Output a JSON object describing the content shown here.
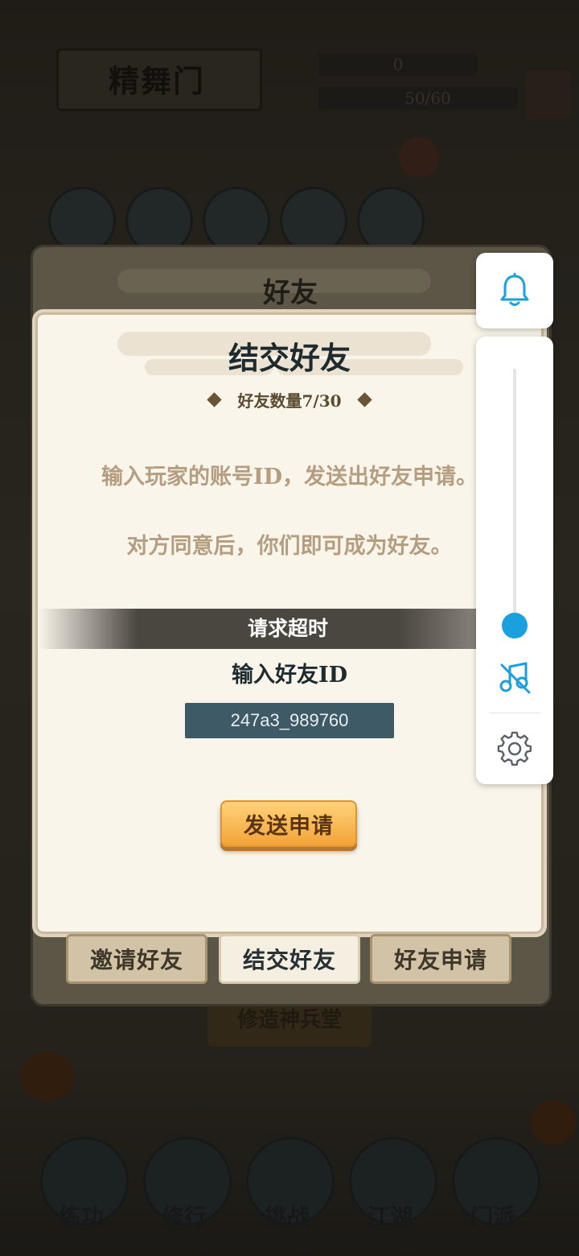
{
  "background": {
    "sect_name": "精舞门",
    "resource_value": "0",
    "stamina_value": "50/60",
    "behind_button_label": "修造神兵堂",
    "bottom_nav": [
      "练功",
      "修行",
      "挑战",
      "江湖",
      "门派"
    ]
  },
  "outer_panel": {
    "title": "好友"
  },
  "card": {
    "title": "结交好友",
    "friend_count_label": "好友数量7/30",
    "description_line1": "输入玩家的账号ID，发送出好友申请。",
    "description_line2": "对方同意后，你们即可成为好友。",
    "status_message": "请求超时",
    "id_label": "输入好友ID",
    "id_value": "247a3_989760",
    "send_button_label": "发送申请"
  },
  "tabs": [
    {
      "label": "邀请好友",
      "active": false
    },
    {
      "label": "结交好友",
      "active": true
    },
    {
      "label": "好友申请",
      "active": false
    }
  ],
  "side_controls": {
    "volume_level_fraction": 0.04,
    "bell_icon": "bell-icon",
    "mute_icon": "music-off-icon",
    "settings_icon": "gear-icon"
  },
  "colors": {
    "accent_blue": "#1aa0de",
    "button_orange": "#f2a437",
    "input_bg": "#3e5a66"
  }
}
